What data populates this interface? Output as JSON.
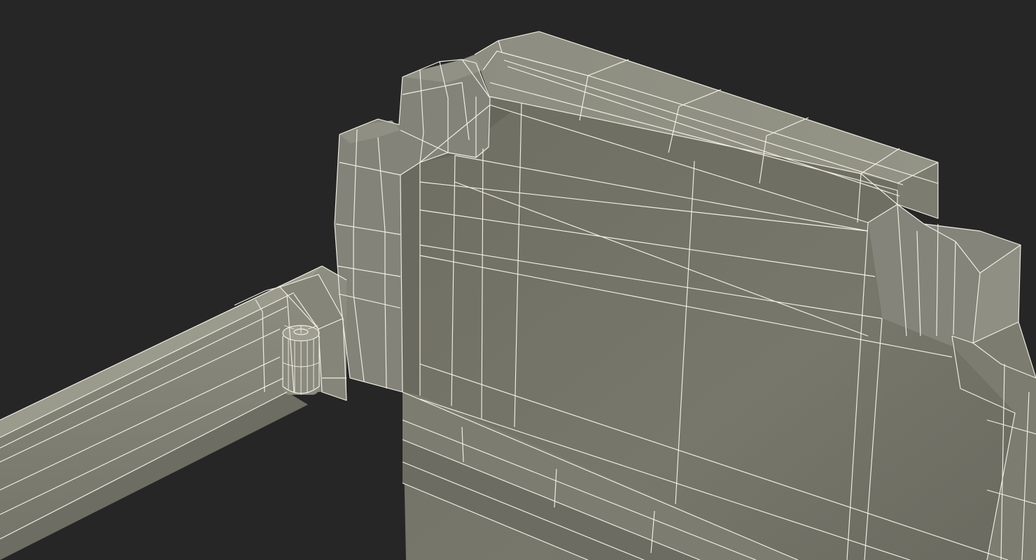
{
  "scene": {
    "subject": "wireframe-bed-frame-corner",
    "colors": {
      "background": "#262626",
      "surface_light": "#8c8c80",
      "surface_mid": "#7a7a6e",
      "surface_dark": "#5e5e55",
      "wire": "#f2f0e4"
    }
  }
}
